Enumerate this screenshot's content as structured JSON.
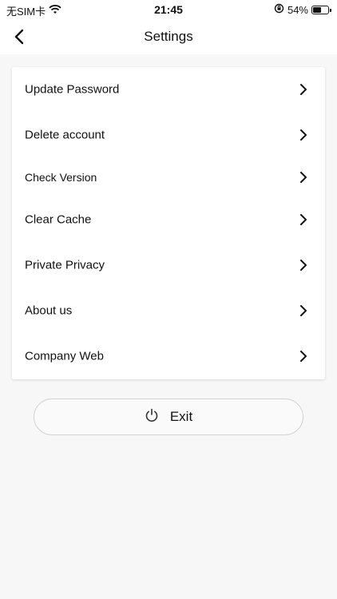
{
  "status_bar": {
    "carrier": "无SIM卡",
    "time": "21:45",
    "battery": "54%",
    "battery_level": 0.54
  },
  "header": {
    "title": "Settings"
  },
  "settings": {
    "items": [
      {
        "label": "Update Password"
      },
      {
        "label": "Delete account"
      },
      {
        "label": "Check Version"
      },
      {
        "label": "Clear Cache"
      },
      {
        "label": "Private Privacy"
      },
      {
        "label": "About us"
      },
      {
        "label": "Company Web"
      }
    ]
  },
  "exit": {
    "label": "Exit"
  }
}
